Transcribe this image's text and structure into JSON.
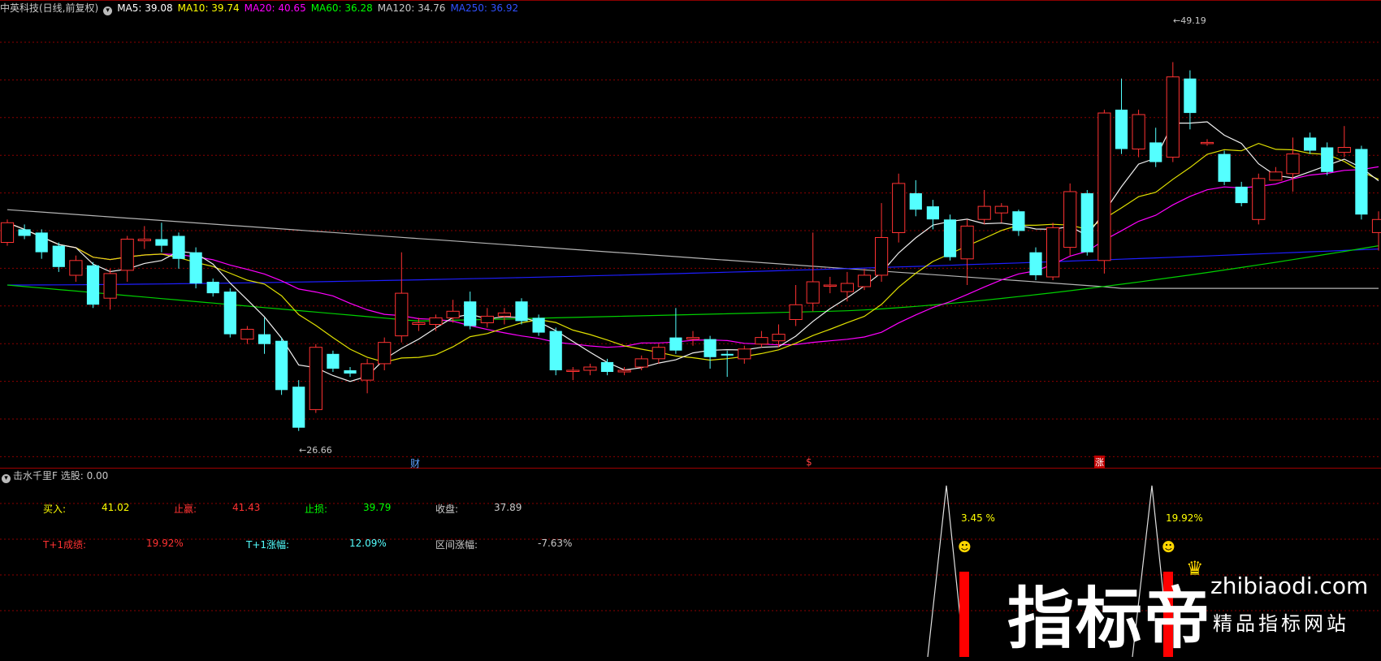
{
  "header": {
    "title": "中英科技(日线,前复权)",
    "ma": [
      {
        "label": "MA5: 39.08",
        "color": "#ffffff"
      },
      {
        "label": "MA10: 39.74",
        "color": "#ffff00"
      },
      {
        "label": "MA20: 40.65",
        "color": "#ff00ff"
      },
      {
        "label": "MA60: 36.28",
        "color": "#00ff00"
      },
      {
        "label": "MA120: 34.76",
        "color": "#c8c8c8"
      },
      {
        "label": "MA250: 36.92",
        "color": "#0000ff"
      }
    ]
  },
  "price_annotations": {
    "high": "49.19",
    "low": "26.66"
  },
  "markers": {
    "cai": "财",
    "s": "$",
    "zhang": "涨"
  },
  "indicator": {
    "name": "击水千里F",
    "select_label": "选股: 0.00"
  },
  "stats": {
    "buy_label": "买入:",
    "buy_value": "41.02",
    "tp_label": "止赢:",
    "tp_value": "41.43",
    "sl_label": "止损:",
    "sl_value": "39.79",
    "close_label": "收盘:",
    "close_value": "37.89",
    "t1_label": "T+1成绩:",
    "t1_value": "19.92%",
    "t1chg_label": "T+1涨幅:",
    "t1chg_value": "12.09%",
    "range_label": "区间涨幅:",
    "range_value": "-7.63%"
  },
  "signals": [
    {
      "pct": "3.45",
      "unit": "%"
    },
    {
      "pct": "19.92",
      "unit": "%"
    }
  ],
  "watermark": {
    "brand": "指标帝",
    "url": "zhibiaodi.com",
    "slogan": "精品指标网站"
  },
  "colors": {
    "up": "#ff3232",
    "down": "#54ffff",
    "grid": "#8b0000",
    "buy_label": "#ffff00",
    "tp_label": "#ff3232",
    "sl_label": "#00ff00",
    "t1chg_label": "#54ffff"
  },
  "chart_data": {
    "type": "candlestick",
    "ylim": [
      25,
      52
    ],
    "candles": [
      [
        38.2,
        39.4,
        38.0,
        39.6
      ],
      [
        39.0,
        38.6,
        38.4,
        39.3
      ],
      [
        38.8,
        37.6,
        37.2,
        39.0
      ],
      [
        38.0,
        36.7,
        36.4,
        38.2
      ],
      [
        36.2,
        37.1,
        35.8,
        37.4
      ],
      [
        36.8,
        34.4,
        34.2,
        37.0
      ],
      [
        34.8,
        36.3,
        34.1,
        36.6
      ],
      [
        36.5,
        38.4,
        35.8,
        38.6
      ],
      [
        38.3,
        38.4,
        37.8,
        39.2
      ],
      [
        38.4,
        38.0,
        37.6,
        39.4
      ],
      [
        38.6,
        37.2,
        36.6,
        38.8
      ],
      [
        37.6,
        35.7,
        35.4,
        37.9
      ],
      [
        35.8,
        35.1,
        34.9,
        36.0
      ],
      [
        35.2,
        32.6,
        32.4,
        35.4
      ],
      [
        32.3,
        32.9,
        32.0,
        33.1
      ],
      [
        32.6,
        32.0,
        31.4,
        33.6
      ],
      [
        32.2,
        29.2,
        28.9,
        32.4
      ],
      [
        29.4,
        26.9,
        26.7,
        29.8
      ],
      [
        28.0,
        31.8,
        27.8,
        32.0
      ],
      [
        31.4,
        30.5,
        30.3,
        31.6
      ],
      [
        30.4,
        30.2,
        30.0,
        30.6
      ],
      [
        29.8,
        30.8,
        29.0,
        31.1
      ],
      [
        30.8,
        32.1,
        30.4,
        32.4
      ],
      [
        32.5,
        35.1,
        32.1,
        37.6
      ],
      [
        33.2,
        33.3,
        32.8,
        33.6
      ],
      [
        33.2,
        33.6,
        32.8,
        33.8
      ],
      [
        33.6,
        34.0,
        33.3,
        34.7
      ],
      [
        34.6,
        33.1,
        32.9,
        35.2
      ],
      [
        33.3,
        33.7,
        33.0,
        34.2
      ],
      [
        33.7,
        33.9,
        33.2,
        34.2
      ],
      [
        34.6,
        33.4,
        33.2,
        34.8
      ],
      [
        33.6,
        32.7,
        32.5,
        33.8
      ],
      [
        32.8,
        30.4,
        30.1,
        33.0
      ],
      [
        30.4,
        30.4,
        29.8,
        30.6
      ],
      [
        30.4,
        30.6,
        30.1,
        30.8
      ],
      [
        30.9,
        30.3,
        30.1,
        31.1
      ],
      [
        30.3,
        30.4,
        30.1,
        30.6
      ],
      [
        30.6,
        31.1,
        30.4,
        31.3
      ],
      [
        31.1,
        31.8,
        30.8,
        32.0
      ],
      [
        32.4,
        31.6,
        31.4,
        34.2
      ],
      [
        32.3,
        32.4,
        31.9,
        32.8
      ],
      [
        32.3,
        31.2,
        30.5,
        32.5
      ],
      [
        31.4,
        31.3,
        30.0,
        31.6
      ],
      [
        31.1,
        31.7,
        30.8,
        31.9
      ],
      [
        32.0,
        32.4,
        31.8,
        32.8
      ],
      [
        32.2,
        32.6,
        31.8,
        33.2
      ],
      [
        33.5,
        34.4,
        33.1,
        35.6
      ],
      [
        34.5,
        35.8,
        34.0,
        38.8
      ],
      [
        35.6,
        35.6,
        35.1,
        36.1
      ],
      [
        35.2,
        35.7,
        34.6,
        36.4
      ],
      [
        35.5,
        36.2,
        35.3,
        36.6
      ],
      [
        36.2,
        38.5,
        35.8,
        40.6
      ],
      [
        38.8,
        41.8,
        38.2,
        42.4
      ],
      [
        41.2,
        40.2,
        39.8,
        42.0
      ],
      [
        40.4,
        39.6,
        39.0,
        40.8
      ],
      [
        39.6,
        37.3,
        37.1,
        39.9
      ],
      [
        37.2,
        39.2,
        35.6,
        39.6
      ],
      [
        39.6,
        40.4,
        39.3,
        41.4
      ],
      [
        40.0,
        40.4,
        39.4,
        40.6
      ],
      [
        40.1,
        38.9,
        38.6,
        40.2
      ],
      [
        37.6,
        36.2,
        35.9,
        37.9
      ],
      [
        36.1,
        39.1,
        35.9,
        39.4
      ],
      [
        37.9,
        41.3,
        37.4,
        41.8
      ],
      [
        41.2,
        37.6,
        37.4,
        41.4
      ],
      [
        37.1,
        46.1,
        36.3,
        46.3
      ],
      [
        46.3,
        43.9,
        43.6,
        48.2
      ],
      [
        43.9,
        46.0,
        43.4,
        46.3
      ],
      [
        44.3,
        43.1,
        42.8,
        45.2
      ],
      [
        43.4,
        48.3,
        43.1,
        49.2
      ],
      [
        48.2,
        46.1,
        45.1,
        48.7
      ],
      [
        44.3,
        44.3,
        44.1,
        44.5
      ],
      [
        43.6,
        41.9,
        41.7,
        43.8
      ],
      [
        41.6,
        40.6,
        40.4,
        41.9
      ],
      [
        39.6,
        42.1,
        39.3,
        42.4
      ],
      [
        42.0,
        42.5,
        42.1,
        42.8
      ],
      [
        42.4,
        43.6,
        41.3,
        44.6
      ],
      [
        44.6,
        43.8,
        43.6,
        44.9
      ],
      [
        44.0,
        42.5,
        42.3,
        44.3
      ],
      [
        43.7,
        44.0,
        43.4,
        45.3
      ],
      [
        43.9,
        39.9,
        39.6,
        44.1
      ],
      [
        38.8,
        39.6,
        37.7,
        40.1
      ]
    ]
  }
}
